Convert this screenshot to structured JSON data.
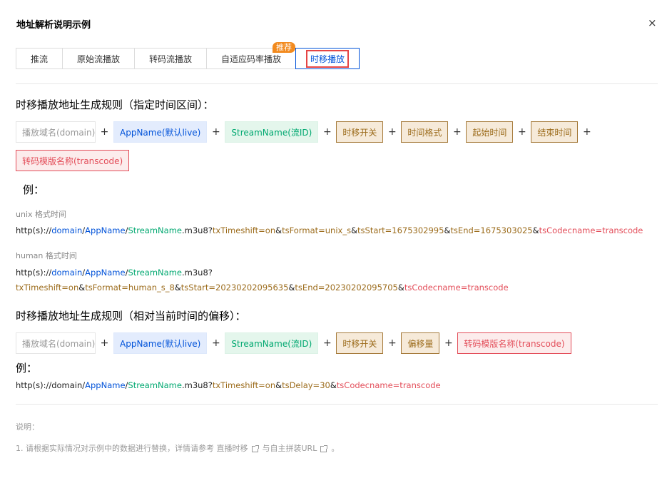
{
  "dialog": {
    "title": "地址解析说明示例",
    "close": "×"
  },
  "tabs": [
    {
      "label": "推流"
    },
    {
      "label": "原始流播放"
    },
    {
      "label": "转码流播放"
    },
    {
      "label": "自适应码率播放"
    },
    {
      "label": "时移播放"
    }
  ],
  "badge": "推荐",
  "section1": {
    "heading": "时移播放地址生成规则（指定时间区间）：",
    "boxes": {
      "domain": "播放域名(domain)",
      "app": "AppName(默认live)",
      "stream": "StreamName(流ID)",
      "shift": "时移开关",
      "format": "时间格式",
      "start": "起始时间",
      "end": "结束时间",
      "code": "转码模版名称(transcode)"
    },
    "plus": "+",
    "example_label": "例：",
    "unix_label": "unix 格式时间",
    "unix_url": {
      "prefix": "http(s)://",
      "domain": "domain",
      "slash": "/",
      "app": "AppName",
      "stream": "StreamName",
      "ext": ".m3u8?",
      "p1": "txTimeshift=on",
      "amp": "&",
      "p2": "tsFormat=unix_s",
      "p3": "tsStart=1675302995",
      "p4": "tsEnd=1675303025",
      "p5": "tsCodecname=transcode"
    },
    "human_label": "human 格式时间",
    "human_url": {
      "prefix": "http(s)://",
      "domain": "domain",
      "slash": "/",
      "app": "AppName",
      "stream": "StreamName",
      "ext": ".m3u8?",
      "p1": "txTimeshift=on",
      "amp": "&",
      "p2": "tsFormat=human_s_8",
      "p3": "tsStart=20230202095635",
      "p4": "tsEnd=20230202095705",
      "p5": "tsCodecname=transcode"
    }
  },
  "section2": {
    "heading": "时移播放地址生成规则（相对当前时间的偏移）：",
    "boxes": {
      "domain": "播放域名(domain)",
      "app": "AppName(默认live)",
      "stream": "StreamName(流ID)",
      "shift": "时移开关",
      "offset": "偏移量",
      "code": "转码模版名称(transcode)"
    },
    "example_label": "例：",
    "url": {
      "prefix": "http(s)://domain/",
      "app": "AppName",
      "slash": "/",
      "stream": "StreamName",
      "ext": ".m3u8?",
      "p1": "txTimeshift=on",
      "amp": "&",
      "p2": "tsDelay=30",
      "p3": "tsCodecname=transcode"
    }
  },
  "notes": {
    "title": "说明：",
    "line_prefix": "1. 请根据实际情况对示例中的数据进行替换，详情请参考",
    "link1": "直播时移",
    "mid": "与",
    "link2": "自主拼装URL",
    "end": "。"
  }
}
